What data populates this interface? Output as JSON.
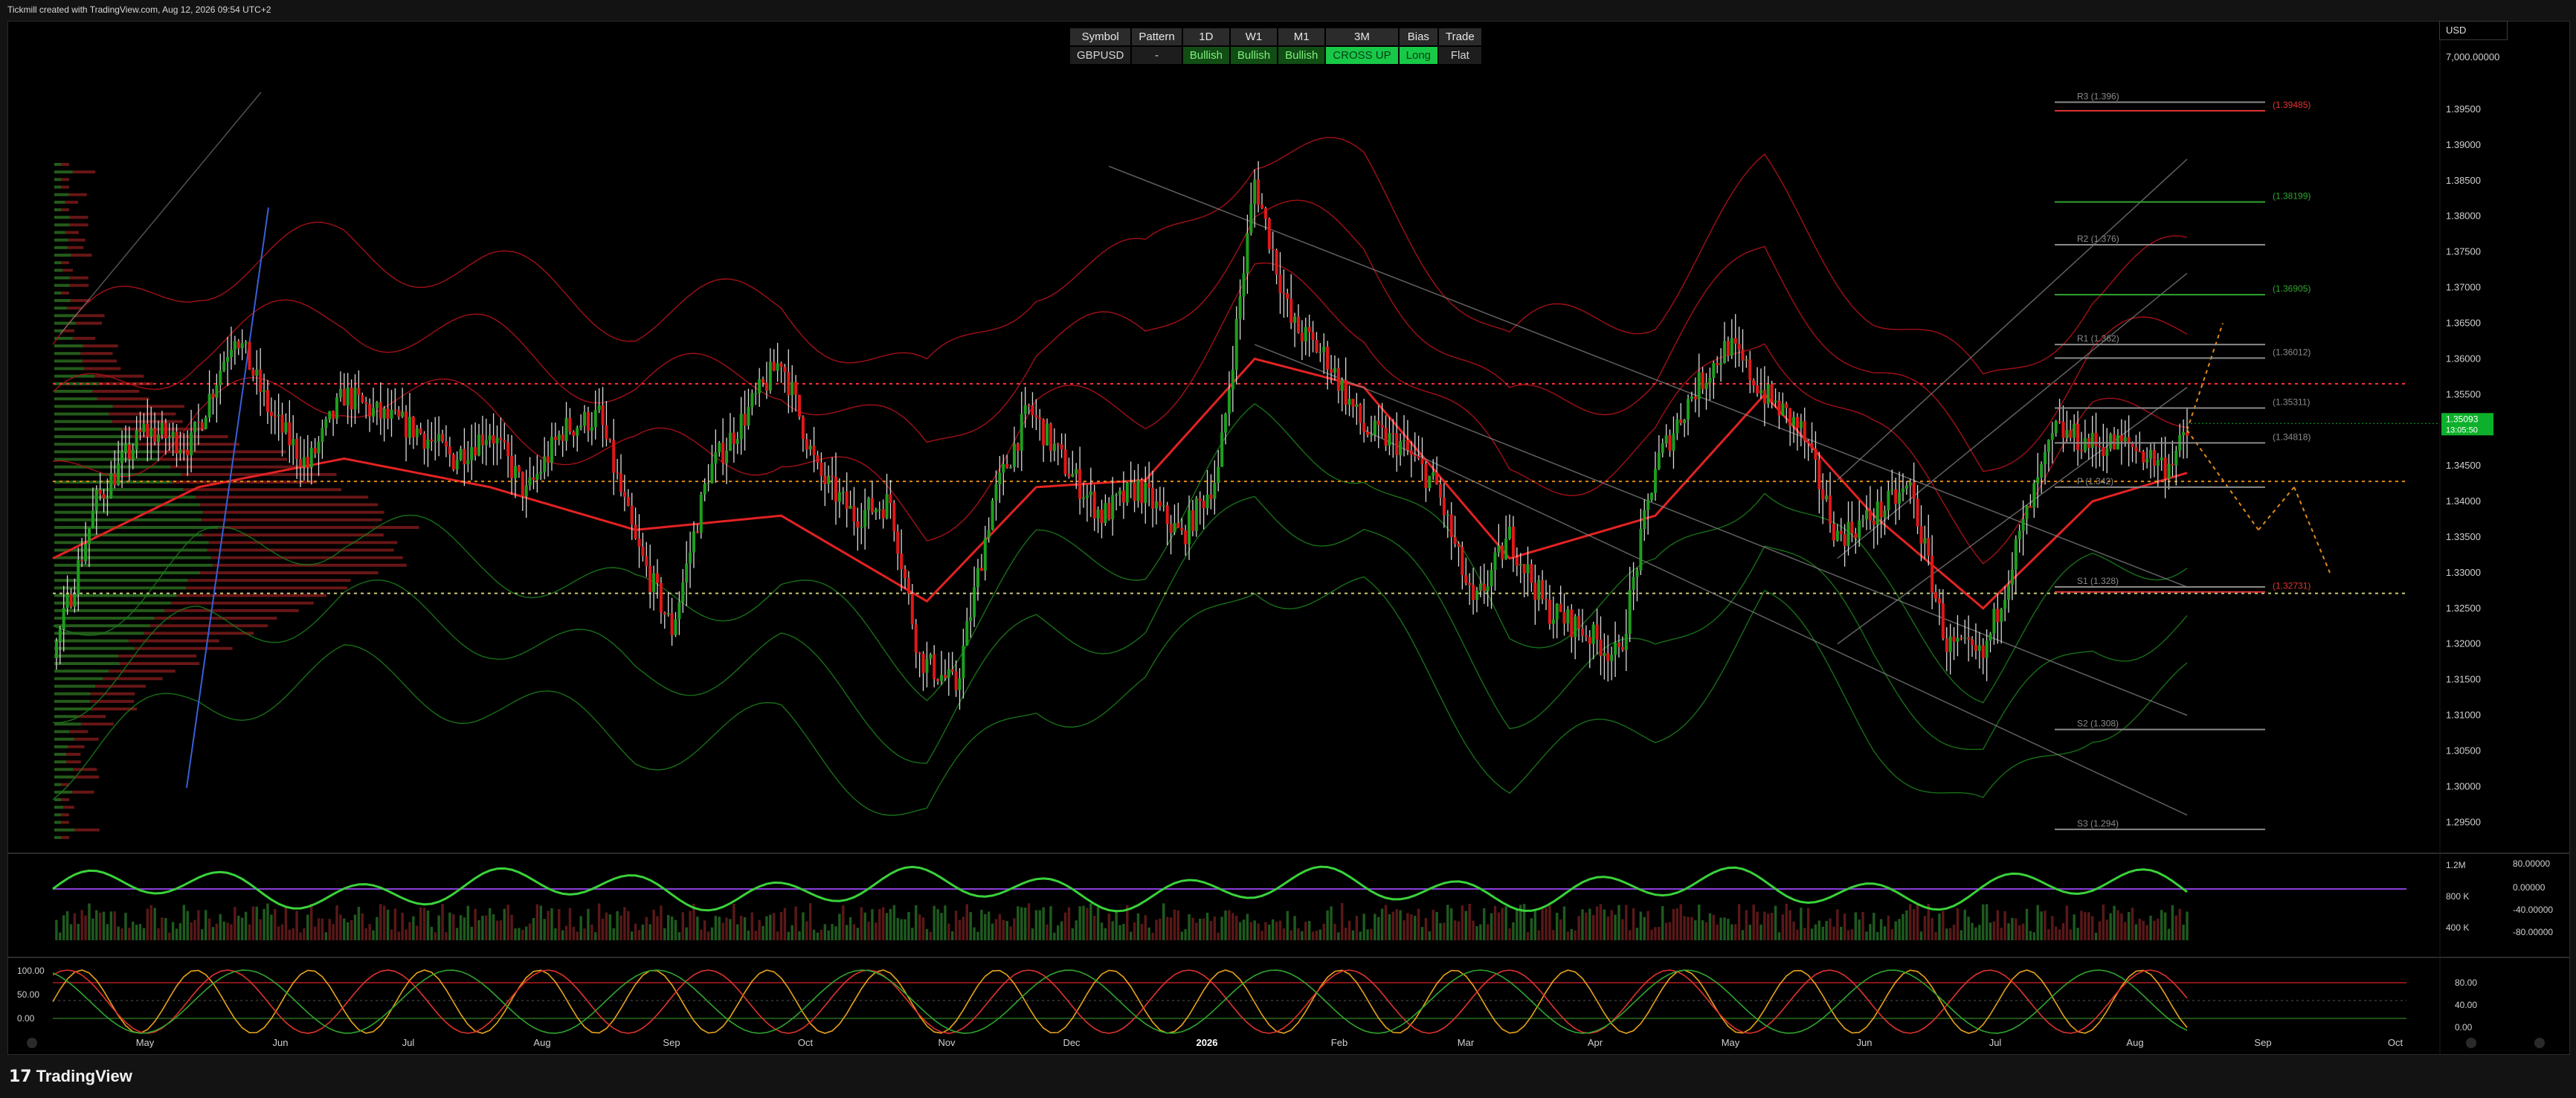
{
  "header": {
    "title": "Tickmill created with TradingView.com, Aug 12, 2026 09:54 UTC+2"
  },
  "status_table": {
    "headers": [
      "Symbol",
      "Pattern",
      "1D",
      "W1",
      "M1",
      "3M",
      "Bias",
      "Trade"
    ],
    "values": [
      "GBPUSD",
      "-",
      "Bullish",
      "Bullish",
      "Bullish",
      "CROSS UP",
      "Long",
      "Flat"
    ]
  },
  "currency_selector": "USD",
  "footer": {
    "brand": "TradingView"
  },
  "colors": {
    "up": "#1e9e1e",
    "down": "#e01818",
    "dashed_red": "#ff3333",
    "dashed_orange": "#e08a1a",
    "dashed_yellow": "#c9c97a",
    "price_badge": "#0db02b",
    "purple_line": "#8a3fd8"
  },
  "chart_data": [
    {
      "type": "candlestick",
      "symbol": "GBPUSD",
      "x_tick_labels": [
        "May",
        "Jun",
        "Jul",
        "Aug",
        "Sep",
        "Oct",
        "Nov",
        "Dec",
        "2026",
        "Feb",
        "Mar",
        "Apr",
        "May",
        "Jun",
        "Jul",
        "Aug",
        "Sep",
        "Oct"
      ],
      "y_tick_labels": [
        "7,000.00000",
        "1.39500",
        "1.39000",
        "1.38500",
        "1.38000",
        "1.37500",
        "1.37000",
        "1.36500",
        "1.36000",
        "1.35500",
        "1.35000",
        "1.34500",
        "1.34000",
        "1.33500",
        "1.33000",
        "1.32500",
        "1.32000",
        "1.31500",
        "1.31000",
        "1.30500",
        "1.30000",
        "1.29500"
      ],
      "ylim": [
        1.292,
        1.4
      ],
      "last_price": {
        "value": "1.35093",
        "countdown": "13:05:50"
      },
      "horizontal_levels": [
        {
          "price": 1.3565,
          "style": "dashed",
          "color": "red"
        },
        {
          "price": 1.3428,
          "style": "dashed",
          "color": "orange"
        },
        {
          "price": 1.3271,
          "style": "dashed",
          "color": "yellow"
        }
      ],
      "pivot_levels": [
        {
          "label": "R3 (1.396)",
          "price": 1.396
        },
        {
          "label": "(1.39485)",
          "price": 1.3948
        },
        {
          "label": "(1.38199)",
          "price": 1.382
        },
        {
          "label": "R2 (1.376)",
          "price": 1.376
        },
        {
          "label": "(1.36905)",
          "price": 1.369
        },
        {
          "label": "R1 (1.362)",
          "price": 1.362
        },
        {
          "label": "(1.36012)",
          "price": 1.3601
        },
        {
          "label": "(1.35311)",
          "price": 1.3531
        },
        {
          "label": "(1.34818)",
          "price": 1.3482
        },
        {
          "label": "P (1.342)",
          "price": 1.342
        },
        {
          "label": "S1 (1.328)",
          "price": 1.328
        },
        {
          "label": "(1.32731)",
          "price": 1.3273
        },
        {
          "label": "S2 (1.308)",
          "price": 1.308
        },
        {
          "label": "S3 (1.294)",
          "price": 1.294
        }
      ],
      "path": [
        [
          0,
          1.318
        ],
        [
          12,
          1.34
        ],
        [
          25,
          1.35
        ],
        [
          38,
          1.348
        ],
        [
          50,
          1.364
        ],
        [
          60,
          1.352
        ],
        [
          70,
          1.345
        ],
        [
          80,
          1.355
        ],
        [
          90,
          1.352
        ],
        [
          100,
          1.35
        ],
        [
          110,
          1.346
        ],
        [
          120,
          1.35
        ],
        [
          130,
          1.341
        ],
        [
          140,
          1.35
        ],
        [
          150,
          1.352
        ],
        [
          160,
          1.334
        ],
        [
          170,
          1.322
        ],
        [
          180,
          1.344
        ],
        [
          190,
          1.352
        ],
        [
          200,
          1.36
        ],
        [
          210,
          1.344
        ],
        [
          220,
          1.338
        ],
        [
          230,
          1.34
        ],
        [
          238,
          1.318
        ],
        [
          248,
          1.314
        ],
        [
          258,
          1.34
        ],
        [
          268,
          1.353
        ],
        [
          278,
          1.345
        ],
        [
          288,
          1.338
        ],
        [
          298,
          1.342
        ],
        [
          310,
          1.335
        ],
        [
          320,
          1.344
        ],
        [
          330,
          1.385
        ],
        [
          340,
          1.365
        ],
        [
          350,
          1.36
        ],
        [
          360,
          1.35
        ],
        [
          370,
          1.348
        ],
        [
          380,
          1.342
        ],
        [
          390,
          1.325
        ],
        [
          400,
          1.335
        ],
        [
          410,
          1.325
        ],
        [
          420,
          1.322
        ],
        [
          430,
          1.318
        ],
        [
          440,
          1.345
        ],
        [
          450,
          1.355
        ],
        [
          460,
          1.362
        ],
        [
          470,
          1.355
        ],
        [
          480,
          1.35
        ],
        [
          490,
          1.335
        ],
        [
          500,
          1.338
        ],
        [
          510,
          1.342
        ],
        [
          520,
          1.32
        ],
        [
          530,
          1.318
        ],
        [
          540,
          1.335
        ],
        [
          550,
          1.35
        ],
        [
          560,
          1.348
        ],
        [
          570,
          1.348
        ],
        [
          580,
          1.345
        ],
        [
          586,
          1.349
        ]
      ],
      "bollinger_center": [
        [
          0,
          1.332
        ],
        [
          40,
          1.342
        ],
        [
          80,
          1.346
        ],
        [
          120,
          1.342
        ],
        [
          160,
          1.336
        ],
        [
          200,
          1.338
        ],
        [
          240,
          1.326
        ],
        [
          270,
          1.342
        ],
        [
          300,
          1.343
        ],
        [
          330,
          1.36
        ],
        [
          360,
          1.356
        ],
        [
          400,
          1.332
        ],
        [
          440,
          1.338
        ],
        [
          470,
          1.355
        ],
        [
          500,
          1.338
        ],
        [
          530,
          1.325
        ],
        [
          560,
          1.34
        ],
        [
          586,
          1.344
        ]
      ],
      "bollinger_bands": [
        {
          "color": "red",
          "offset": 0.03
        },
        {
          "color": "red",
          "offset": 0.02
        },
        {
          "color": "red",
          "offset": 0.01
        },
        {
          "color": "green",
          "offset": -0.01
        },
        {
          "color": "green",
          "offset": -0.02
        },
        {
          "color": "green",
          "offset": -0.03
        }
      ],
      "trend_channel": [
        {
          "from": [
            1.387,
            290
          ],
          "to": [
            1.328,
            586
          ]
        },
        {
          "from": [
            1.362,
            330
          ],
          "to": [
            1.31,
            586
          ]
        },
        {
          "from": [
            1.35,
            360
          ],
          "to": [
            1.296,
            586
          ]
        }
      ],
      "projection_channel": [
        {
          "from": [
            1.343,
            490
          ],
          "to": [
            1.388,
            586
          ]
        },
        {
          "from": [
            1.332,
            490
          ],
          "to": [
            1.372,
            586
          ]
        },
        {
          "from": [
            1.32,
            490
          ],
          "to": [
            1.356,
            586
          ]
        }
      ],
      "projection_path": [
        {
          "from": [
            1.35,
            0
          ],
          "to": [
            1.365,
            8
          ],
          "style": "dashed"
        },
        {
          "from": [
            1.35,
            0
          ],
          "to": [
            1.336,
            16
          ],
          "style": "dashed"
        },
        {
          "from": [
            1.336,
            16
          ],
          "to": [
            1.342,
            24
          ],
          "style": "dashed"
        },
        {
          "from": [
            1.342,
            24
          ],
          "to": [
            1.33,
            32
          ],
          "style": "dashed"
        }
      ],
      "volume_profile": {
        "rows_count": 90,
        "green_share": 0.45
      }
    },
    {
      "type": "oscillator_and_volume",
      "y_tick_labels_left": [
        "1.2M",
        "800 K",
        "400 K"
      ],
      "y_tick_labels_right": [
        "80.00000",
        "0.00000",
        "-40.00000",
        "-80.00000"
      ]
    },
    {
      "type": "stochastic",
      "y_tick_labels_left": [
        "100.00",
        "50.00",
        "0.00"
      ],
      "y_tick_labels_right": [
        "80.00",
        "40.00",
        "0.00"
      ]
    }
  ]
}
